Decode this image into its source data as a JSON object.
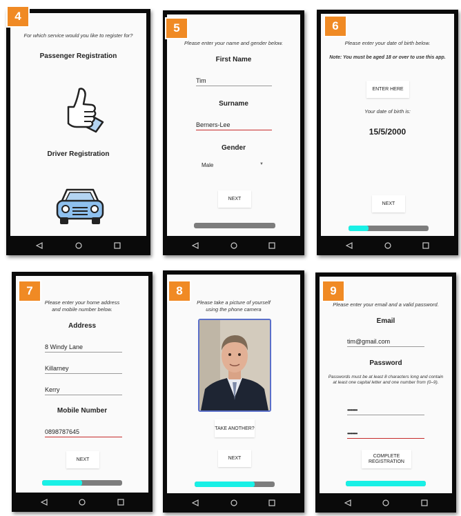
{
  "colors": {
    "accent": "#f08a24",
    "progress_fill": "#19f0e6",
    "progress_track": "#7d7d7d",
    "error_underline": "#c62828"
  },
  "nav_icons": [
    "back-triangle-icon",
    "home-circle-icon",
    "recents-square-icon"
  ],
  "screens": [
    {
      "step": "4",
      "instruction": "For which service would you like to register for?",
      "passenger_label": "Passenger Registration",
      "driver_label": "Driver Registration",
      "icons": [
        "thumbs-up-icon",
        "car-icon"
      ]
    },
    {
      "step": "5",
      "instruction": "Please enter your name and gender below.",
      "first_name_label": "First Name",
      "first_name_value": "Tim",
      "surname_label": "Surname",
      "surname_value": "Berners-Lee",
      "gender_label": "Gender",
      "gender_value": "Male",
      "next_label": "NEXT",
      "progress": 0.0
    },
    {
      "step": "6",
      "instruction": "Please enter your date of birth below.",
      "note": "Note: You must be aged 18 or over to use this app.",
      "enter_label": "ENTER HERE",
      "dob_caption": "Your date of birth is:",
      "dob_value": "15/5/2000",
      "next_label": "NEXT",
      "progress": 0.25
    },
    {
      "step": "7",
      "instruction_line1": "Please enter your home address",
      "instruction_line2": "and mobile number below.",
      "address_label": "Address",
      "address_line1": "8 Windy Lane",
      "address_line2": "Killarney",
      "address_line3": "Kerry",
      "mobile_label": "Mobile Number",
      "mobile_value": "0898787645",
      "next_label": "NEXT",
      "progress": 0.5
    },
    {
      "step": "8",
      "instruction_line1": "Please take a picture of yourself",
      "instruction_line2": "using the phone camera",
      "take_another_label": "TAKE ANOTHER?",
      "next_label": "NEXT",
      "progress": 0.75
    },
    {
      "step": "9",
      "instruction": "Please enter your email and a valid password.",
      "email_label": "Email",
      "email_value": "tim@gmail.com",
      "password_label": "Password",
      "password_rules": "Passwords must be at least 8 characters long and contain at least one capital letter and one number from (0–9).",
      "password_value": "••••••••",
      "confirm_value": "••••••••",
      "complete_line1": "COMPLETE",
      "complete_line2": "REGISTRATION",
      "progress": 1.0
    }
  ]
}
